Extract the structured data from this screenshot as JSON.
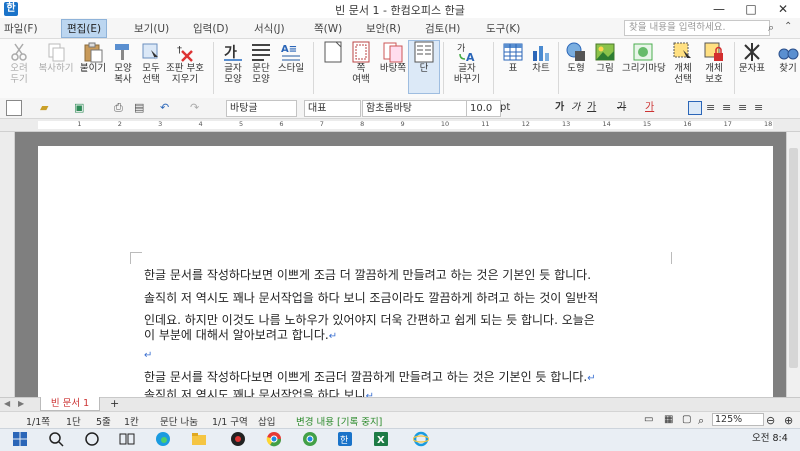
{
  "window": {
    "title": "빈 문서 1 - 한컴오피스 한글",
    "app_icon": "한",
    "minimize": "—",
    "maximize": "□",
    "close": "✕"
  },
  "menu": {
    "items": [
      "파일(F)",
      "편집(E)",
      "보기(U)",
      "입력(D)",
      "서식(J)",
      "쪽(W)",
      "보안(R)",
      "검토(H)",
      "도구(K)"
    ],
    "active": "편집(E)",
    "search_placeholder": "찾을 내용을 입력하세요."
  },
  "ribbon": {
    "buttons": [
      {
        "label": "오려\n두기",
        "icon": "scissors-icon"
      },
      {
        "label": "복사하기",
        "icon": "copy-icon"
      },
      {
        "label": "붙이기",
        "icon": "paste-icon"
      },
      {
        "label": "모양\n복사",
        "icon": "format-painter-icon"
      },
      {
        "label": "모두\n선택",
        "icon": "select-all-icon"
      },
      {
        "label": "조판 부호\n지우기",
        "icon": "eraser-icon"
      },
      {
        "label": "글자\n모양",
        "icon": "char-shape-icon"
      },
      {
        "label": "문단\n모양",
        "icon": "paragraph-icon"
      },
      {
        "label": "스타일",
        "icon": "style-icon"
      },
      {
        "label": "",
        "icon": "page-icon"
      },
      {
        "label": "쪽\n여백",
        "icon": "margin-icon"
      },
      {
        "label": "바탕쪽",
        "icon": "master-page-icon"
      },
      {
        "label": "단",
        "icon": "columns-icon"
      },
      {
        "label": "글자\n바꾸기",
        "icon": "replace-char-icon"
      },
      {
        "label": "표",
        "icon": "table-icon"
      },
      {
        "label": "차트",
        "icon": "chart-icon"
      },
      {
        "label": "도형",
        "icon": "shape-icon"
      },
      {
        "label": "그림",
        "icon": "picture-icon"
      },
      {
        "label": "그리기마당",
        "icon": "clipart-icon"
      },
      {
        "label": "개체\n선택",
        "icon": "object-select-icon"
      },
      {
        "label": "개체\n보호",
        "icon": "object-protect-icon"
      },
      {
        "label": "문자표",
        "icon": "symbol-icon"
      },
      {
        "label": "찾기",
        "icon": "find-icon"
      }
    ]
  },
  "toolbar": {
    "style": "바탕글",
    "lang": "대표",
    "font": "함초롬바탕",
    "size": "10.0",
    "unit": "pt",
    "bold": "가",
    "italic": "가",
    "underline": "가",
    "strike": "가",
    "color": "가"
  },
  "ruler": {
    "numbers": [
      "1",
      "2",
      "3",
      "4",
      "5",
      "6",
      "7",
      "8",
      "9",
      "10",
      "11",
      "12",
      "13",
      "14",
      "15",
      "16",
      "17",
      "18"
    ]
  },
  "document": {
    "lines": [
      "한글 문서를 작성하다보면 이쁘게 조금 더 깔끔하게 만들려고 하는 것은 기본인 듯 합니다.",
      "솔직히 저 역시도 꽤나 문서작업을 하다 보니 조금이라도 깔끔하게 하려고 하는 것이 일반적",
      "인데요. 하지만 이것도 나름 노하우가 있어야지 더욱 간편하고 쉽게 되는 듯 합니다. 오늘은",
      "이 부분에 대해서 알아보려고 합니다.",
      "",
      "한글 문서를 작성하다보면 이쁘게 조금더 깔끔하게 만들려고 하는 것은 기본인 듯 합니다.",
      "솔직히 저 역시도 꽤나 문서작업을 하다 보니"
    ],
    "para_mark": "↵"
  },
  "tabs": {
    "doc_tab": "빈 문서 1",
    "add": "+"
  },
  "status": {
    "page": "1/1쪽",
    "section": "1단",
    "line": "5줄",
    "col": "1칸",
    "para_break": "문단 나눔",
    "zone": "1/1 구역",
    "mode": "삽입",
    "track": "변경 내용 [기록 중지]",
    "zoom": "125%"
  },
  "taskbar": {
    "clock": "오전 8:4"
  }
}
